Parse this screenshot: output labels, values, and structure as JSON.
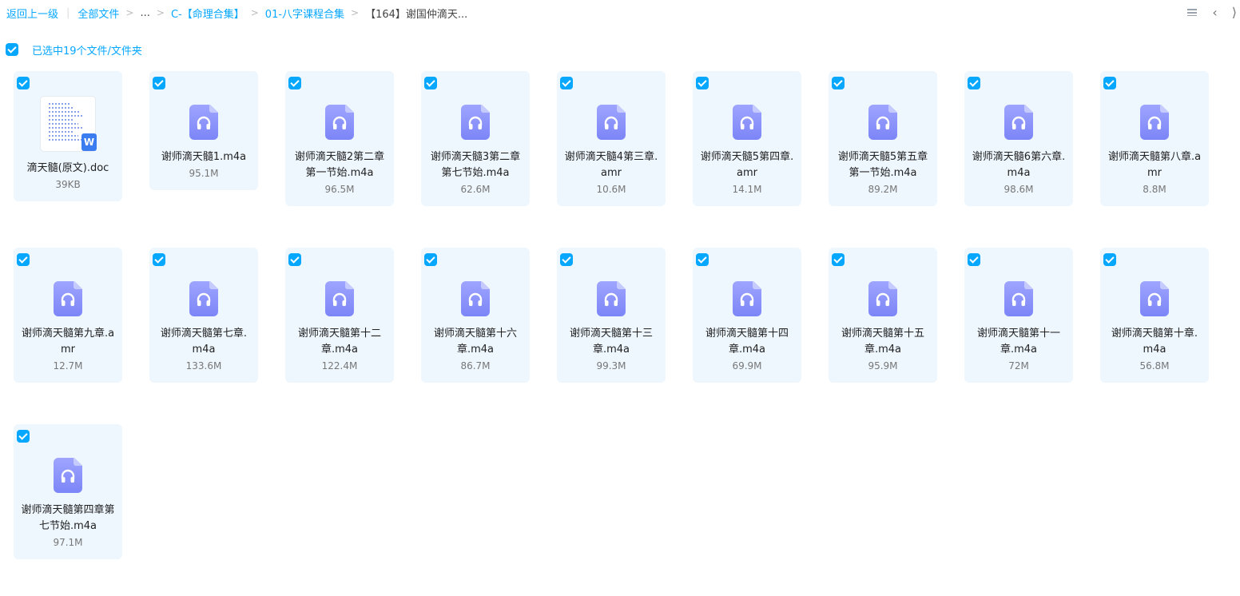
{
  "breadcrumb": {
    "back": "返回上一级",
    "items": [
      "全部文件",
      "...",
      "C-【命理合集】",
      "01-八字课程合集"
    ],
    "current": "【164】谢国仲滴天..."
  },
  "top_right": {
    "list_view_icon": "list-view-icon",
    "prev_arrow": "‹",
    "next_arrow": "⟩"
  },
  "selection": {
    "text": "已选中19个文件/文件夹"
  },
  "colors": {
    "accent": "#06a7ff",
    "card_bg": "#eef7fe",
    "audio_icon": "#8a92fb"
  },
  "files": [
    {
      "name": "滴天髓(原文).doc",
      "size": "39KB",
      "type": "doc",
      "icon": "word-doc-icon"
    },
    {
      "name": "谢师滴天髓1.m4a",
      "size": "95.1M",
      "type": "audio",
      "icon": "audio-file-icon"
    },
    {
      "name": "谢师滴天髓2第二章第一节始.m4a",
      "size": "96.5M",
      "type": "audio",
      "icon": "audio-file-icon"
    },
    {
      "name": "谢师滴天髓3第二章第七节始.m4a",
      "size": "62.6M",
      "type": "audio",
      "icon": "audio-file-icon"
    },
    {
      "name": "谢师滴天髓4第三章.amr",
      "size": "10.6M",
      "type": "audio",
      "icon": "audio-file-icon"
    },
    {
      "name": "谢师滴天髓5第四章.amr",
      "size": "14.1M",
      "type": "audio",
      "icon": "audio-file-icon"
    },
    {
      "name": "谢师滴天髓5第五章第一节始.m4a",
      "size": "89.2M",
      "type": "audio",
      "icon": "audio-file-icon"
    },
    {
      "name": "谢师滴天髓6第六章.m4a",
      "size": "98.6M",
      "type": "audio",
      "icon": "audio-file-icon"
    },
    {
      "name": "谢师滴天髓第八章.amr",
      "size": "8.8M",
      "type": "audio",
      "icon": "audio-file-icon"
    },
    {
      "name": "谢师滴天髓第九章.amr",
      "size": "12.7M",
      "type": "audio",
      "icon": "audio-file-icon"
    },
    {
      "name": "谢师滴天髓第七章.m4a",
      "size": "133.6M",
      "type": "audio",
      "icon": "audio-file-icon"
    },
    {
      "name": "谢师滴天髓第十二章.m4a",
      "size": "122.4M",
      "type": "audio",
      "icon": "audio-file-icon"
    },
    {
      "name": "谢师滴天髓第十六章.m4a",
      "size": "86.7M",
      "type": "audio",
      "icon": "audio-file-icon"
    },
    {
      "name": "谢师滴天髓第十三章.m4a",
      "size": "99.3M",
      "type": "audio",
      "icon": "audio-file-icon"
    },
    {
      "name": "谢师滴天髓第十四章.m4a",
      "size": "69.9M",
      "type": "audio",
      "icon": "audio-file-icon"
    },
    {
      "name": "谢师滴天髓第十五章.m4a",
      "size": "95.9M",
      "type": "audio",
      "icon": "audio-file-icon"
    },
    {
      "name": "谢师滴天髓第十一章.m4a",
      "size": "72M",
      "type": "audio",
      "icon": "audio-file-icon"
    },
    {
      "name": "谢师滴天髓第十章.m4a",
      "size": "56.8M",
      "type": "audio",
      "icon": "audio-file-icon"
    },
    {
      "name": "谢师滴天髓第四章第七节始.m4a",
      "size": "97.1M",
      "type": "audio",
      "icon": "audio-file-icon"
    }
  ]
}
